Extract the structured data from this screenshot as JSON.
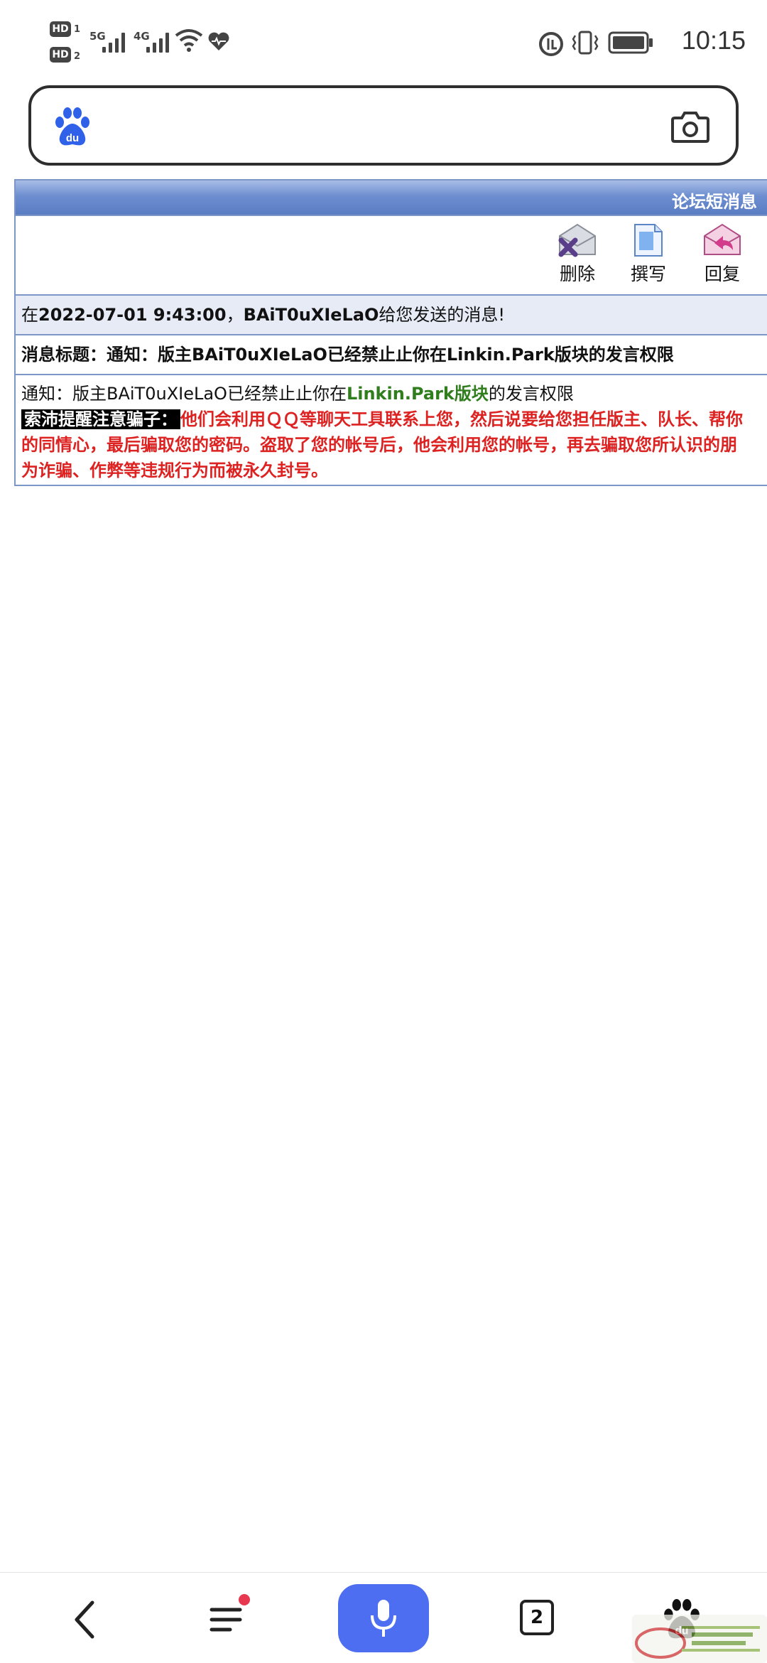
{
  "status_bar": {
    "hd1": "HD",
    "hd1_sub": "1",
    "hd2": "HD",
    "hd2_sub": "2",
    "net1": "5G",
    "net2": "4G",
    "time": "10:15",
    "icons": [
      "hd-icon",
      "signal-icon",
      "wifi-icon",
      "heart-icon",
      "data-saver-icon",
      "vibrate-icon",
      "battery-icon"
    ]
  },
  "search": {
    "placeholder": ""
  },
  "panel": {
    "title": "论坛短消息",
    "toolbar": [
      {
        "label": "删除",
        "icon": "delete-icon"
      },
      {
        "label": "撰写",
        "icon": "compose-icon"
      },
      {
        "label": "回复",
        "icon": "reply-icon"
      }
    ],
    "info": {
      "prefix": "在",
      "datetime": "2022-07-01 9:43:00",
      "comma": "，",
      "sender": "BAiT0uXIeLaO",
      "suffix": "给您发送的消息!"
    },
    "subject": {
      "label": "消息标题：",
      "text": "通知：版主BAiT0uXIeLaO已经禁止止你在Linkin.Park版块的发言权限"
    },
    "body": {
      "prefix": "通知：版主BAiT0uXIeLaO已经禁止止你在",
      "forum_link": "Linkin.Park版块",
      "suffix": "的发言权限"
    },
    "warning": {
      "label": "索沛提醒注意骗子：",
      "line1": "他们会利用ＱＱ等聊天工具联系上您，然后说要给您担任版主、队长、帮你",
      "line2": "的同情心，最后骗取您的密码。盗取了您的帐号后，他会利用您的帐号，再去骗取您所认识的朋",
      "line3": "为诈骗、作弊等违规行为而被永久封号。"
    }
  },
  "bottom_nav": {
    "tab_count": "2",
    "items": [
      "back-icon",
      "menu-icon",
      "voice-search-button",
      "tabs-button",
      "baidu-home-icon"
    ]
  },
  "colors": {
    "header_blue": "#5a7cc2",
    "mic_blue": "#4e6ef2",
    "warning_red": "#dd2222",
    "link_green": "#2f7d1c"
  }
}
